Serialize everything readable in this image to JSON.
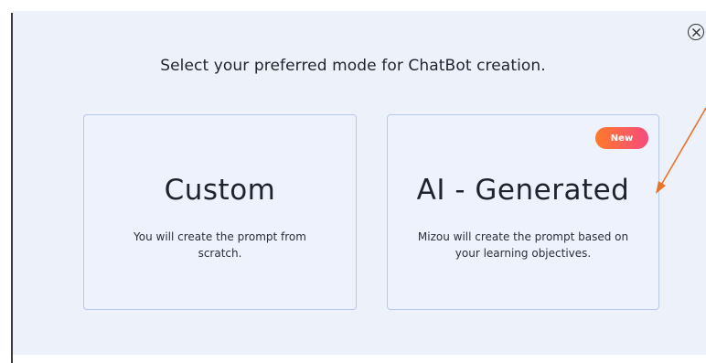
{
  "modal": {
    "heading": "Select your preferred mode for ChatBot creation.",
    "close_icon": "close-circle-icon"
  },
  "cards": [
    {
      "title": "Custom",
      "description": "You will create the prompt from scratch."
    },
    {
      "title": "AI - Generated",
      "description": "Mizou will create the prompt based on your learning objectives.",
      "badge": "New"
    }
  ],
  "colors": {
    "modal_background": "#edf1f9",
    "card_background": "#edf2fd",
    "card_border": "#b9c9ec",
    "badge_gradient_start": "#ff7a2a",
    "badge_gradient_end": "#f64b7f",
    "annotation_arrow": "#e8732a"
  }
}
